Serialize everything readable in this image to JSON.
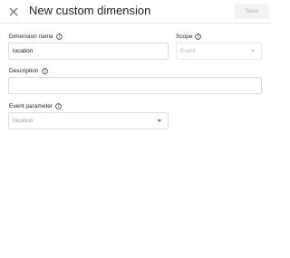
{
  "dialog": {
    "title": "New custom dimension",
    "close_icon": "close-icon",
    "save_label": "Save"
  },
  "fields": {
    "dimension_name": {
      "label": "Dimension name",
      "value": "location"
    },
    "scope": {
      "label": "Scope",
      "value": "Event",
      "disabled": true
    },
    "description": {
      "label": "Description",
      "value": ""
    },
    "event_parameter": {
      "label": "Event parameter",
      "value": "location"
    }
  },
  "colors": {
    "border": "#dadce0",
    "muted_text": "#9aa0a6",
    "save_bg": "#f1f3f4"
  }
}
